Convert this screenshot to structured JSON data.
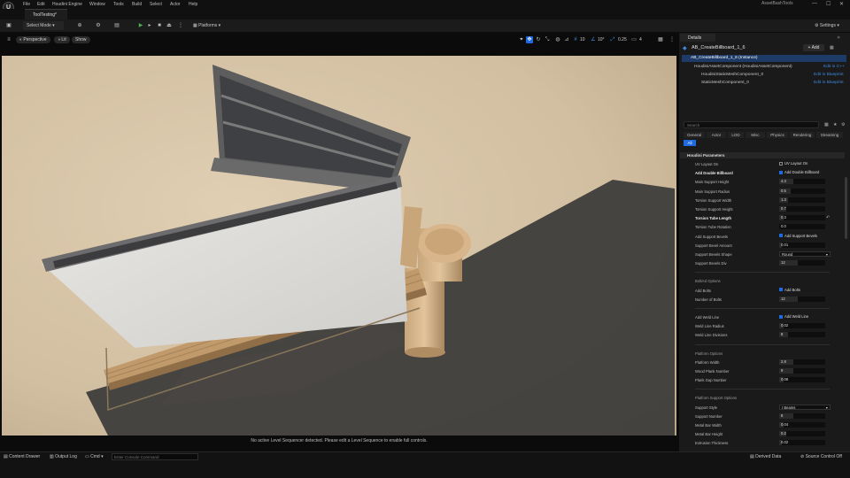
{
  "menubar": {
    "logo": "U",
    "items": [
      "File",
      "Edit",
      "Houdini Engine",
      "Window",
      "Tools",
      "Build",
      "Select",
      "Actor",
      "Help"
    ],
    "project": "AssetBashTools"
  },
  "tabs": {
    "level": "ToolTesting*"
  },
  "toolbar": {
    "select_mode": "Select Mode",
    "platforms": "Platforms",
    "settings": "Settings"
  },
  "viewport": {
    "perspective": "Perspective",
    "lit": "Lit",
    "show": "Show",
    "grid_snap": "10",
    "angle_snap": "10°",
    "scale_snap": "0.25",
    "camera_speed": "4",
    "sequencer_message": "No active Level Sequencer detected. Please edit a Level Sequence to enable full controls."
  },
  "bottombar": {
    "content_drawer": "Content Drawer",
    "output_log": "Output Log",
    "cmd": "Cmd",
    "cmd_placeholder": "Enter Console Command",
    "derived_data": "Derived Data",
    "source_control": "Source Control Off"
  },
  "details": {
    "tab": "Details",
    "actor_name": "AB_CreateBillboard_1_6",
    "add_label": "+ Add",
    "components": [
      {
        "label": "AB_CreateBillboard_1_6 (Instance)",
        "link": ""
      },
      {
        "label": "HoudiniAssetComponent (HoudiniAssetComponent)",
        "link": "Edit in C++"
      },
      {
        "label": "HoudiniStaticMeshComponent_0",
        "link": "Edit in Blueprint"
      },
      {
        "label": "StaticMeshComponent_0",
        "link": "Edit in Blueprint"
      }
    ],
    "search_placeholder": "Search",
    "categories": [
      "General",
      "Actor",
      "LOD",
      "Misc",
      "Physics",
      "Rendering",
      "Streaming",
      "All"
    ],
    "section": "Houdini Parameters",
    "props": [
      {
        "label": "UV Layout On",
        "type": "check",
        "value": "UV Layout On",
        "on": false,
        "bold": false
      },
      {
        "label": "Add Double Billboard",
        "type": "check",
        "value": "Add Double Billboard",
        "on": true,
        "bold": true
      },
      {
        "label": "Main Support Height",
        "type": "num",
        "value": "4.3",
        "fill": 0.3,
        "bold": false
      },
      {
        "label": "Main Support Radius",
        "type": "num",
        "value": "0.5",
        "fill": 0.25,
        "bold": false
      },
      {
        "label": "Torsion Support Width",
        "type": "num",
        "value": "1.3",
        "fill": 0.2,
        "bold": false
      },
      {
        "label": "Torsion Support Height",
        "type": "num",
        "value": "0.7",
        "fill": 0.15,
        "bold": false
      },
      {
        "label": "Torsion Tube Length",
        "type": "num",
        "value": "0.3",
        "fill": 0.1,
        "bold": true,
        "reset": true
      },
      {
        "label": "Torsion Tube Rotation",
        "type": "num",
        "value": "0.0",
        "fill": 0.0,
        "bold": false
      },
      {
        "label": "Add Support Bevels",
        "type": "check",
        "value": "Add Support Bevels",
        "on": true,
        "bold": false
      },
      {
        "label": "Support Bevel Amount",
        "type": "num",
        "value": "0.01",
        "fill": 0.05,
        "bold": false
      },
      {
        "label": "Support Bevels Shape",
        "type": "select",
        "value": "Round",
        "bold": false
      },
      {
        "label": "Support Bevels Div",
        "type": "num",
        "value": "12",
        "fill": 0.4,
        "bold": false
      }
    ],
    "bolt_group": "Bolt/ed Options",
    "bolt_props": [
      {
        "label": "Add Bolts",
        "type": "check",
        "value": "Add Bolts",
        "on": true
      },
      {
        "label": "Number of Bolts",
        "type": "num",
        "value": "12",
        "fill": 0.4
      }
    ],
    "weld_props": [
      {
        "label": "Add Weld Line",
        "type": "check",
        "value": "Add Weld Line",
        "on": true
      },
      {
        "label": "Weld Line Radius",
        "type": "num",
        "value": "0.02",
        "fill": 0.1
      },
      {
        "label": "Weld Line Divisions",
        "type": "num",
        "value": "8",
        "fill": 0.2
      }
    ],
    "platform_group": "Platform Options",
    "platform_props": [
      {
        "label": "Platform Width",
        "type": "num",
        "value": "2.8",
        "fill": 0.3
      },
      {
        "label": "Wood Plank Number",
        "type": "num",
        "value": "9",
        "fill": 0.3
      },
      {
        "label": "Plank Gap Number",
        "type": "num",
        "value": "0.08",
        "fill": 0.1
      }
    ],
    "platform_support_group": "Platform Support Options",
    "platform_support_props": [
      {
        "label": "Support Style",
        "type": "select",
        "value": "I Beams"
      },
      {
        "label": "Support Number",
        "type": "num",
        "value": "8",
        "fill": 0.3
      },
      {
        "label": "Metal Bar Width",
        "type": "num",
        "value": "0.04",
        "fill": 0.1
      },
      {
        "label": "Metal Bar Height",
        "type": "num",
        "value": "0.2",
        "fill": 0.15
      },
      {
        "label": "Extrusion Thickness",
        "type": "num",
        "value": "0.02",
        "fill": 0.05
      }
    ]
  },
  "colors": {
    "accent": "#1f6ae0",
    "link": "#3d8be0",
    "scene_bg": "#d6c4a8"
  }
}
